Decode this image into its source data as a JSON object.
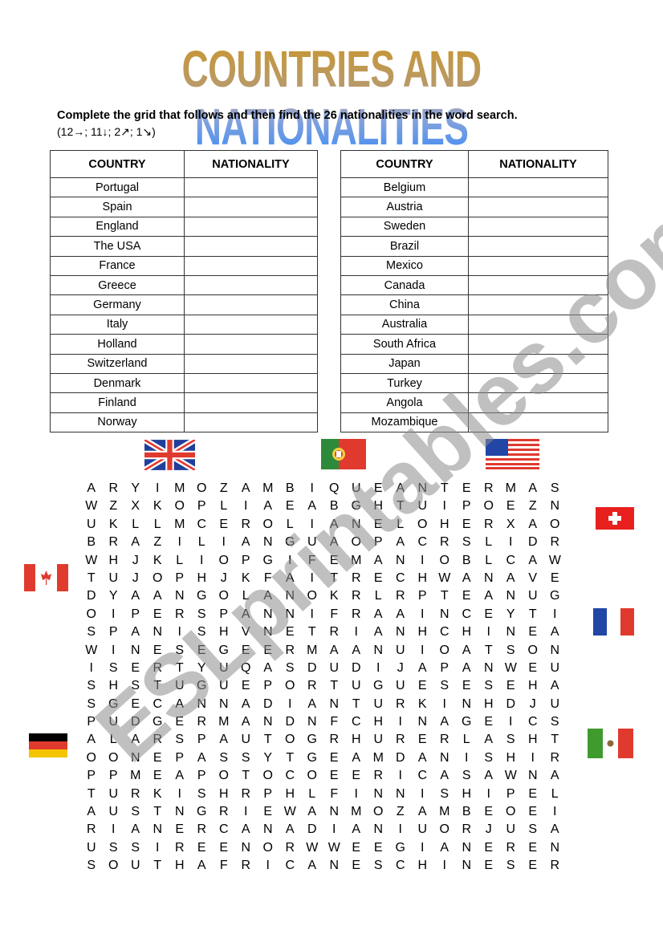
{
  "title": "COUNTRIES AND NATIONALITIES",
  "instructions": "Complete the grid that follows and then find the 26 nationalities in the word search.",
  "hint": "(12→; 11↓; 2↗; 1↘)",
  "tables": [
    {
      "headers": [
        "COUNTRY",
        "NATIONALITY"
      ],
      "countries": [
        "Portugal",
        "Spain",
        "England",
        "The USA",
        "France",
        "Greece",
        "Germany",
        "Italy",
        "Holland",
        "Switzerland",
        "Denmark",
        "Finland",
        "Norway"
      ]
    },
    {
      "headers": [
        "COUNTRY",
        "NATIONALITY"
      ],
      "countries": [
        "Belgium",
        "Austria",
        "Sweden",
        "Brazil",
        "Mexico",
        "Canada",
        "China",
        "Australia",
        "South Africa",
        "Japan",
        "Turkey",
        "Angola",
        "Mozambique"
      ]
    }
  ],
  "flags": [
    "uk-flag",
    "portugal-flag",
    "usa-flag",
    "switzerland-flag",
    "canada-flag",
    "france-flag",
    "germany-flag",
    "mexico-flag"
  ],
  "colors": {
    "red": "#e03a2f",
    "blue": "#2146a6",
    "green": "#2d8a3a",
    "mexico_green": "#3f9b2e"
  },
  "watermark": "ESLprintables.com",
  "word_search": [
    "ARYIMOZAMBIQUEANTERMAS",
    "WZXKOPLIAEABGHTUIPOEZN",
    "UKLLMCEROLIANELOHERXAO",
    "BRAZILIANGUAOPACRSLIDR",
    "WHJKLIOPGIFEMANIOBLCAW",
    "TUJOPHJKFAITRECHWANAVE",
    "DYAANGOLANOKRLRPTEANUG",
    "OIPERSPANNIFRAAINCEYTI",
    "SPANISHVNETRIANHCHINEA",
    "WINESEGEERMAANUIOATSON",
    "ISERTYUQASDUDIJAPANWEU",
    "SHSTUGUEPORTUGUESESEHA",
    "SGECANNADIANTURKINHDJU",
    "PUDGERMANDNFCHINAGEICS",
    "ALARSPAUTOGRHURERLASHT",
    "OONEPASSYTGEAMDANISHIR",
    "PPMEAPOTOCOEERICASAWNA",
    "TURKISHRPHLFINNISHIPEL",
    "AUSTNGRIEWANMOZAMBEOEI",
    "RIANERCANADIANIUORJUSA",
    "USSIREENORWWEEGIANEREN",
    "SOUTHAFRICANESCHINESER"
  ]
}
